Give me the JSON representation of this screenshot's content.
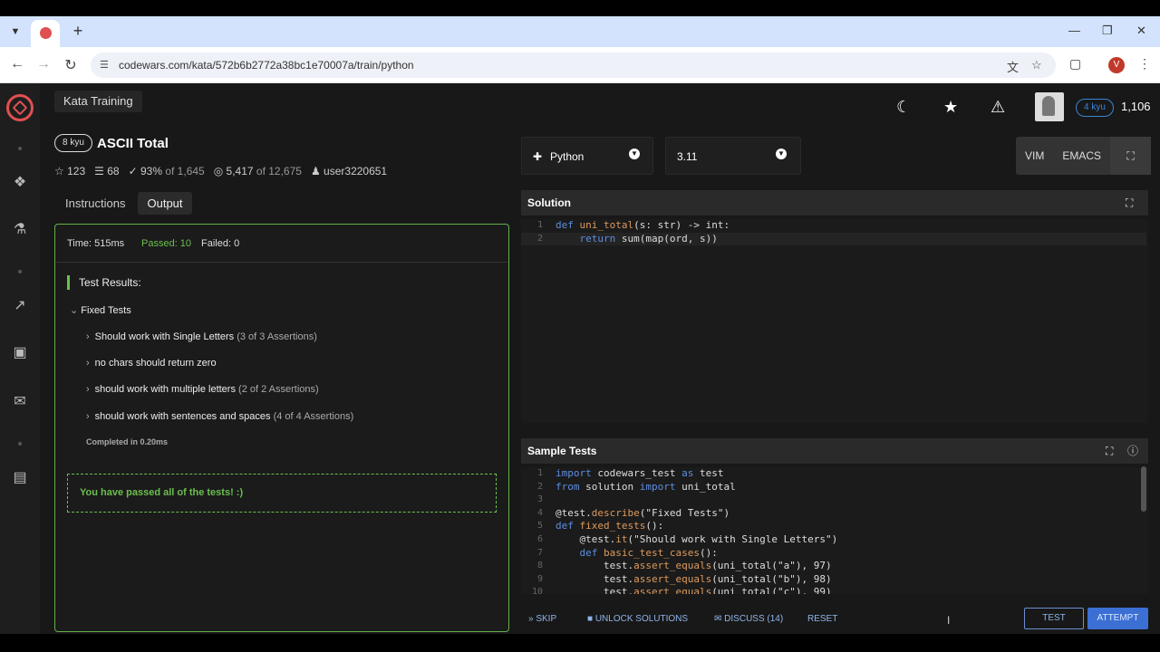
{
  "browser": {
    "url": "codewars.com/kata/572b6b2772a38bc1e70007a/train/python",
    "profile_initial": "V"
  },
  "app": {
    "page_tab_title": "Kata Training",
    "user": {
      "rank": "4 kyu",
      "honor": "1,106"
    }
  },
  "kata": {
    "rank": "8 kyu",
    "title": "ASCII Total",
    "stars": "123",
    "collections": "68",
    "satisfaction": "93%",
    "satisfaction_of": "of 1,645",
    "completions": "5,417",
    "completions_of": "of 12,675",
    "author": "user3220651"
  },
  "tabs": [
    "Instructions",
    "Output"
  ],
  "output": {
    "time": "Time: 515ms",
    "passed": "Passed: 10",
    "failed": "Failed: 0",
    "results_title": "Test Results:",
    "group": "Fixed Tests",
    "tests": [
      {
        "name": "Should work with Single Letters",
        "assertions": "(3 of 3 Assertions)"
      },
      {
        "name": "no chars should return zero",
        "assertions": ""
      },
      {
        "name": "should work with multiple letters",
        "assertions": "(2 of 2 Assertions)"
      },
      {
        "name": "should work with sentences and spaces",
        "assertions": "(4 of 4 Assertions)"
      }
    ],
    "completed": "Completed in 0.20ms",
    "success": "You have passed all of the tests! :)"
  },
  "editor": {
    "language": "Python",
    "version": "3.11",
    "modes": [
      "VIM",
      "EMACS"
    ],
    "solution_title": "Solution",
    "sample_title": "Sample Tests"
  },
  "footer": {
    "skip": "SKIP",
    "unlock": "UNLOCK SOLUTIONS",
    "discuss": "DISCUSS (14)",
    "reset": "RESET",
    "test": "TEST",
    "attempt": "ATTEMPT"
  },
  "colors": {
    "brand_red": "#e05050",
    "pass_green": "#6bbf4e",
    "accent_blue": "#3b6fd4"
  }
}
